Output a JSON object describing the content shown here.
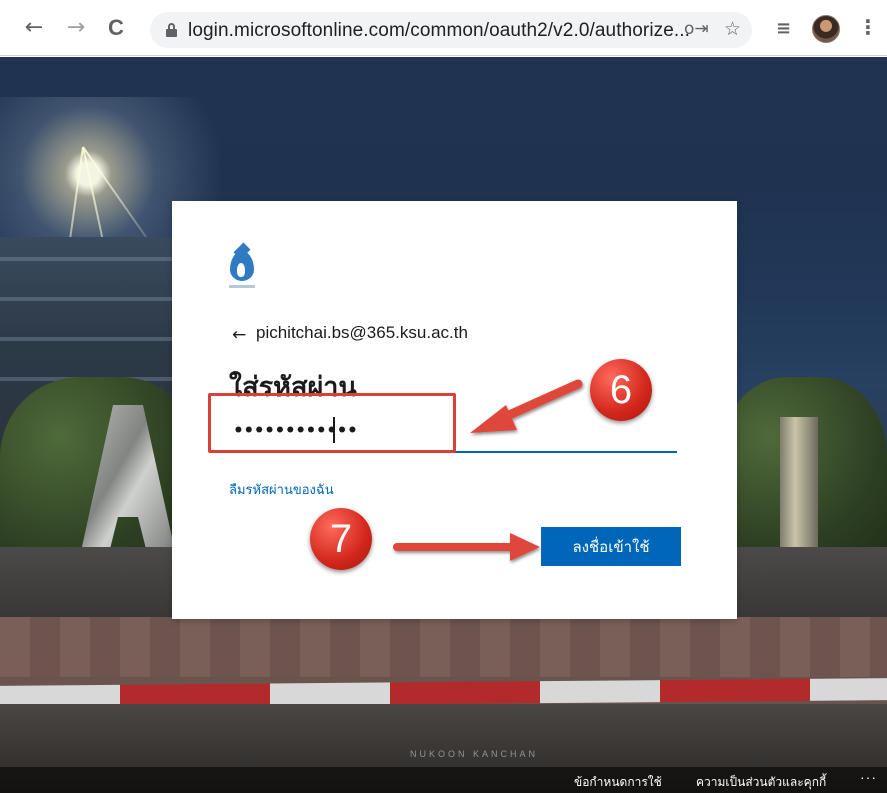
{
  "browser": {
    "url": "login.microsoftonline.com/common/oauth2/v2.0/authorize...",
    "back_icon": "←",
    "forward_icon": "→",
    "reload_icon": "C",
    "star_icon": "☆",
    "key_icon": "o⇥",
    "queue_icon": "≡",
    "menu_icon": "⋮"
  },
  "signin": {
    "identity": "pichitchai.bs@365.ksu.ac.th",
    "back_arrow": "←",
    "heading": "ใส่รหัสผ่าน",
    "password_masked": "••••••••••••",
    "forgot_link": "ลืมรหัสผ่านของฉัน",
    "signin_button": "ลงชื่อเข้าใช้"
  },
  "footer": {
    "terms": "ข้อกำหนดการใช้",
    "privacy": "ความเป็นส่วนตัวและคุกกี้",
    "more": "···"
  },
  "background": {
    "watermark": "NUKOON KANCHAN"
  },
  "annotations": {
    "step_password": "6",
    "step_signin": "7",
    "arrow_color": "#e0473a",
    "badge_color": "#d8403a"
  },
  "colors": {
    "accent": "#0067b8",
    "logo": "#2e7bc4"
  }
}
